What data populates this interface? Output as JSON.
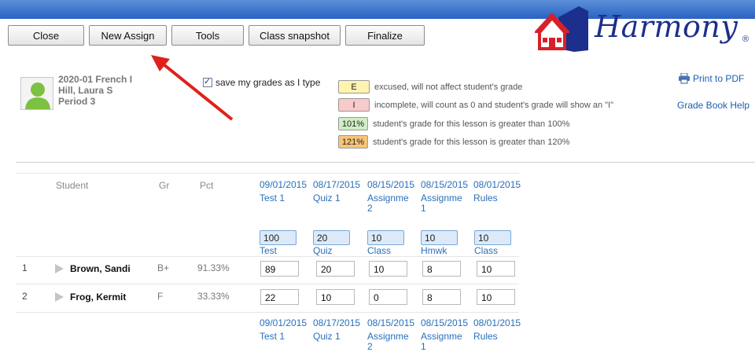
{
  "toolbar": {
    "close": "Close",
    "new_assign": "New Assign",
    "tools": "Tools",
    "class_snapshot": "Class snapshot",
    "finalize": "Finalize"
  },
  "brand": {
    "name": "Harmony",
    "mark": "®"
  },
  "class_info": {
    "course": "2020-01 French I",
    "teacher": "Hill, Laura S",
    "period": "Period 3"
  },
  "save_option": {
    "label": "save my grades as I type",
    "checked": true
  },
  "legend": [
    {
      "badge": "E",
      "text": "excused, will not affect student's grade",
      "color": "#fff3b0"
    },
    {
      "badge": "I",
      "text": "incomplete, will count as 0 and student's grade will show an \"I\"",
      "color": "#f8caca"
    },
    {
      "badge": "101%",
      "text": "student's grade for this lesson is greater than 100%",
      "color": "#cfeec4"
    },
    {
      "badge": "121%",
      "text": "student's grade for this lesson is greater than 120%",
      "color": "#f7c579"
    }
  ],
  "links": {
    "print": "Print to PDF",
    "help": "Grade Book Help"
  },
  "columns": {
    "student": "Student",
    "grade": "Gr",
    "pct": "Pct"
  },
  "assignments": [
    {
      "date": "09/01/2015",
      "name1": "Test 1",
      "name2": "",
      "max": "100",
      "category": "Test"
    },
    {
      "date": "08/17/2015",
      "name1": "Quiz 1",
      "name2": "",
      "max": "20",
      "category": "Quiz"
    },
    {
      "date": "08/15/2015",
      "name1": "Assignme",
      "name2": "2",
      "max": "10",
      "category": "Class"
    },
    {
      "date": "08/15/2015",
      "name1": "Assignme",
      "name2": "1",
      "max": "10",
      "category": "Hmwk"
    },
    {
      "date": "08/01/2015",
      "name1": "Rules",
      "name2": "",
      "max": "10",
      "category": "Class"
    }
  ],
  "students": [
    {
      "num": "1",
      "name": "Brown, Sandi",
      "grade": "B+",
      "pct": "91.33%",
      "scores": [
        "89",
        "20",
        "10",
        "8",
        "10"
      ]
    },
    {
      "num": "2",
      "name": "Frog, Kermit",
      "grade": "F",
      "pct": "33.33%",
      "scores": [
        "22",
        "10",
        "0",
        "8",
        "10"
      ]
    }
  ],
  "colors": {
    "topbar": "#2a62c2",
    "link": "#1a5fb4",
    "logo": "#1c2f8c",
    "house": "#d8202a",
    "arrow": "#e0201a"
  }
}
